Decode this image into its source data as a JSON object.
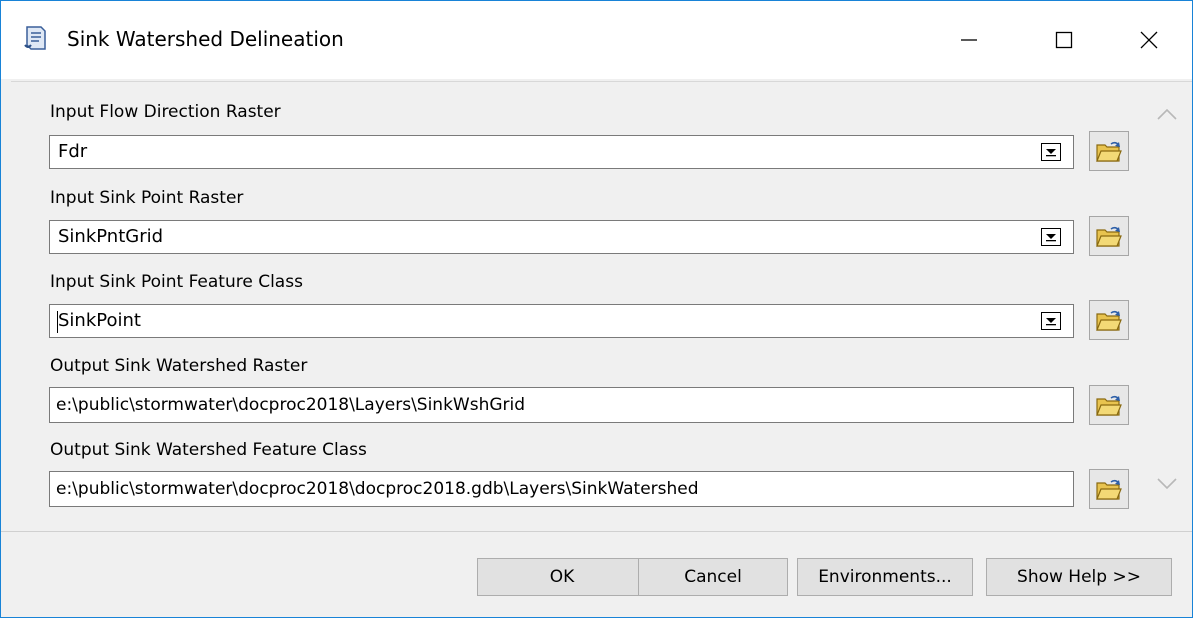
{
  "window": {
    "title": "Sink Watershed Delineation",
    "icon": "script-scroll-icon",
    "controls": [
      "minimize-icon",
      "maximize-icon",
      "close-icon"
    ],
    "accent_color": "#1883d7"
  },
  "fields": [
    {
      "label": "Input Flow Direction Raster",
      "type": "combo",
      "value": "Fdr"
    },
    {
      "label": "Input Sink Point Raster",
      "type": "combo",
      "value": "SinkPntGrid"
    },
    {
      "label": "Input Sink Point Feature Class",
      "type": "combo",
      "value": "SinkPoint"
    },
    {
      "label": "Output Sink Watershed Raster",
      "type": "text",
      "value": "e:\\public\\stormwater\\docproc2018\\Layers\\SinkWshGrid"
    },
    {
      "label": "Output Sink Watershed Feature Class",
      "type": "text",
      "value": "e:\\public\\stormwater\\docproc2018\\docproc2018.gdb\\Layers\\SinkWatershed"
    }
  ],
  "buttons": {
    "ok": "OK",
    "cancel": "Cancel",
    "environments": "Environments...",
    "show_help": "Show Help >>"
  }
}
